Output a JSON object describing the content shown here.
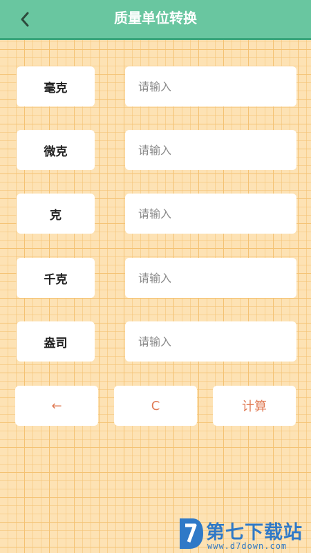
{
  "header": {
    "title": "质量单位转换",
    "back_icon": "chevron-left-icon"
  },
  "units": [
    {
      "label": "毫克",
      "value": "",
      "placeholder": "请输入"
    },
    {
      "label": "微克",
      "value": "",
      "placeholder": "请输入"
    },
    {
      "label": "克",
      "value": "",
      "placeholder": "请输入"
    },
    {
      "label": "千克",
      "value": "",
      "placeholder": "请输入"
    },
    {
      "label": "盎司",
      "value": "",
      "placeholder": "请输入"
    }
  ],
  "keypad": {
    "backspace_label": "←",
    "clear_label": "C",
    "calculate_label": "计算"
  },
  "watermark": {
    "text": "第七下载站",
    "url": "www.d7down.com"
  },
  "colors": {
    "header_bg": "#69c6a0",
    "grid_bg": "#fde2b4",
    "grid_line": "#f4c273",
    "accent_text": "#e07b55",
    "watermark": "#2f79c7"
  }
}
